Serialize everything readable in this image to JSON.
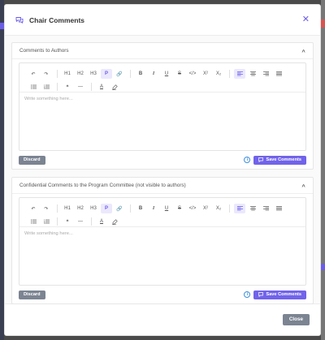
{
  "modal": {
    "title": "Chair Comments",
    "close_label": "Close"
  },
  "toolbar": {
    "h1": "H1",
    "h2": "H2",
    "h3": "H3",
    "p": "P",
    "bold": "B",
    "italic": "I",
    "underline": "U",
    "strike": "S",
    "code": "</>",
    "superscript": "X²",
    "subscript": "X₂",
    "text_color": "A"
  },
  "sections": [
    {
      "title": "Comments to Authors",
      "placeholder": "Write something here...",
      "discard_label": "Discard",
      "save_label": "Save Comments"
    },
    {
      "title": "Confidential Comments to the Program Committee (not visible to authors)",
      "placeholder": "Write something here...",
      "discard_label": "Discard",
      "save_label": "Save Comments"
    }
  ],
  "colors": {
    "accent": "#7163ea",
    "neutral_button": "#7c8492",
    "info": "#3c8fe0"
  }
}
